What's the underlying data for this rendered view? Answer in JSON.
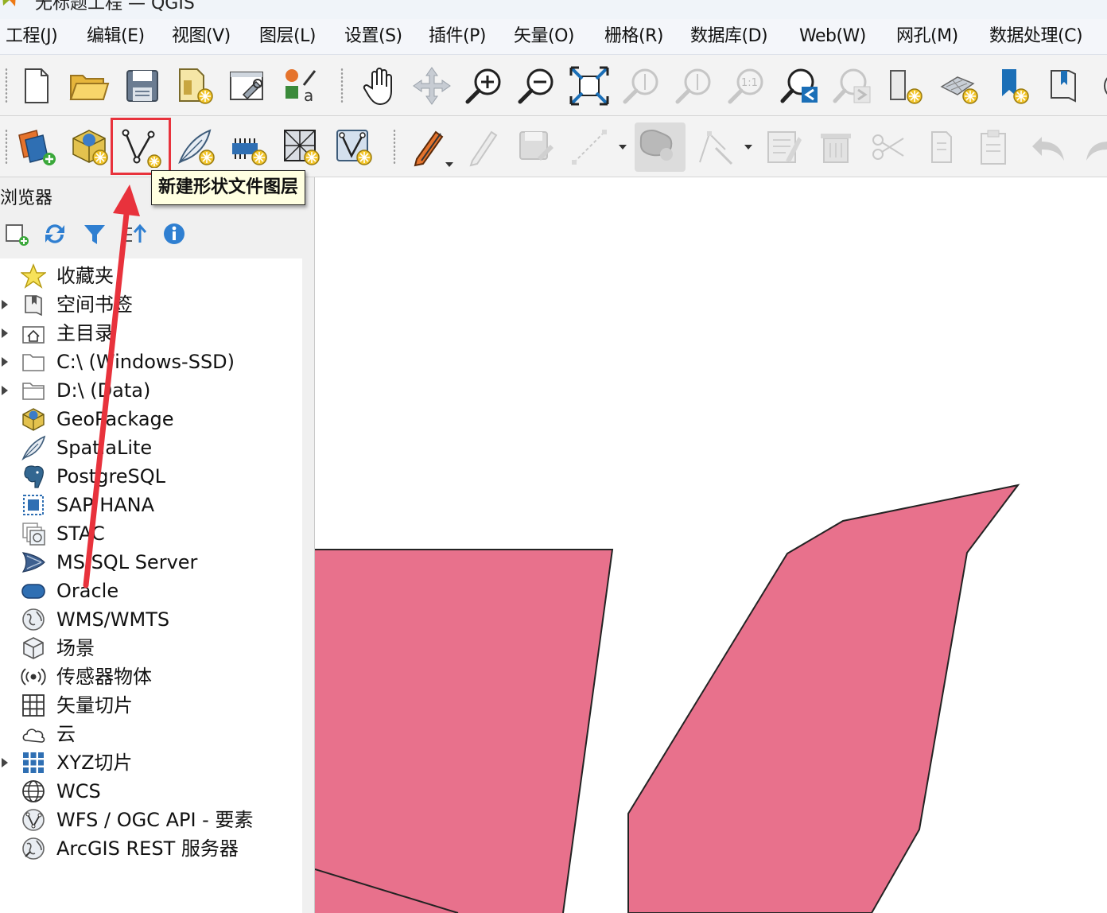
{
  "window": {
    "title": "无标题工程 — QGIS",
    "app_icon": "qgis-logo-icon"
  },
  "menubar": {
    "items": [
      {
        "label": "工程(J)"
      },
      {
        "label": "编辑(E)"
      },
      {
        "label": "视图(V)"
      },
      {
        "label": "图层(L)"
      },
      {
        "label": "设置(S)"
      },
      {
        "label": "插件(P)"
      },
      {
        "label": "矢量(O)"
      },
      {
        "label": "栅格(R)"
      },
      {
        "label": "数据库(D)"
      },
      {
        "label": "Web(W)"
      },
      {
        "label": "网孔(M)"
      },
      {
        "label": "数据处理(C)"
      }
    ]
  },
  "toolbar_file_nav": {
    "icons": [
      "new-project-icon",
      "open-project-icon",
      "save-project-icon",
      "new-print-layout-icon",
      "layout-manager-icon",
      "style-manager-icon",
      "pan-icon",
      "pan-to-selection-icon",
      "zoom-in-icon",
      "zoom-out-icon",
      "zoom-full-icon",
      "zoom-to-selection-icon",
      "zoom-to-layer-icon",
      "zoom-native-icon",
      "zoom-last-icon",
      "zoom-next-icon",
      "new-map-view-icon",
      "new-3d-map-view-icon",
      "new-spatial-bookmark-icon",
      "show-bookmarks-icon",
      "refresh-icon"
    ]
  },
  "toolbar_layers_edit": {
    "icons": [
      "data-source-manager-icon",
      "new-geopackage-layer-icon",
      "new-shapefile-layer-icon",
      "new-spatialite-layer-icon",
      "new-temporary-scratch-layer-icon",
      "new-virtual-layer-icon",
      "new-mesh-layer-icon",
      "current-edits-icon",
      "toggle-editing-icon",
      "save-layer-edits-icon",
      "digitize-line-icon",
      "add-polygon-feature-icon",
      "vertex-tool-icon",
      "modify-attributes-icon",
      "delete-selected-icon",
      "cut-features-icon",
      "copy-features-icon",
      "paste-features-icon",
      "undo-icon",
      "redo-icon"
    ],
    "highlighted_tool": "new-shapefile-layer-icon"
  },
  "tooltip": {
    "text": "新建形状文件图层"
  },
  "browser": {
    "title": "浏览器",
    "tool_icons": [
      "add-selected-layers-icon",
      "refresh-icon",
      "filter-icon",
      "collapse-all-icon",
      "properties-info-icon"
    ],
    "items": [
      {
        "label": "收藏夹",
        "icon": "star-icon",
        "expandable": false
      },
      {
        "label": "空间书签",
        "icon": "bookmark-icon",
        "expandable": true
      },
      {
        "label": "主目录",
        "icon": "home-folder-icon",
        "expandable": true
      },
      {
        "label": "C:\\ (Windows-SSD)",
        "icon": "folder-icon",
        "expandable": true
      },
      {
        "label": "D:\\ (Data)",
        "icon": "folder-icon",
        "expandable": true
      },
      {
        "label": "GeoPackage",
        "icon": "geopackage-icon",
        "expandable": false
      },
      {
        "label": "SpatiaLite",
        "icon": "spatialite-feather-icon",
        "expandable": false
      },
      {
        "label": "PostgreSQL",
        "icon": "postgresql-elephant-icon",
        "expandable": false
      },
      {
        "label": "SAP HANA",
        "icon": "sap-hana-icon",
        "expandable": false
      },
      {
        "label": "STAC",
        "icon": "stac-icon",
        "expandable": false
      },
      {
        "label": "MS SQL Server",
        "icon": "mssql-server-icon",
        "expandable": false
      },
      {
        "label": "Oracle",
        "icon": "oracle-icon",
        "expandable": false
      },
      {
        "label": "WMS/WMTS",
        "icon": "globe-icon",
        "expandable": false
      },
      {
        "label": "场景",
        "icon": "3d-scene-cube-icon",
        "expandable": false
      },
      {
        "label": "传感器物体",
        "icon": "sensor-icon",
        "expandable": false
      },
      {
        "label": "矢量切片",
        "icon": "vector-tile-grid-icon",
        "expandable": false
      },
      {
        "label": "云",
        "icon": "cloud-icon",
        "expandable": false
      },
      {
        "label": "XYZ切片",
        "icon": "xyz-tiles-grid-icon",
        "expandable": true
      },
      {
        "label": "WCS",
        "icon": "wcs-globe-icon",
        "expandable": false
      },
      {
        "label": "WFS / OGC API - 要素",
        "icon": "wfs-globe-icon",
        "expandable": false
      },
      {
        "label": "ArcGIS REST 服务器",
        "icon": "arcgis-rest-globe-icon",
        "expandable": false
      }
    ]
  },
  "map": {
    "polygon_fill": "#e8718c",
    "polygon_stroke": "#232323"
  },
  "annotation": {
    "highlight_color": "#e8323c",
    "arrow_color": "#e8323c"
  }
}
